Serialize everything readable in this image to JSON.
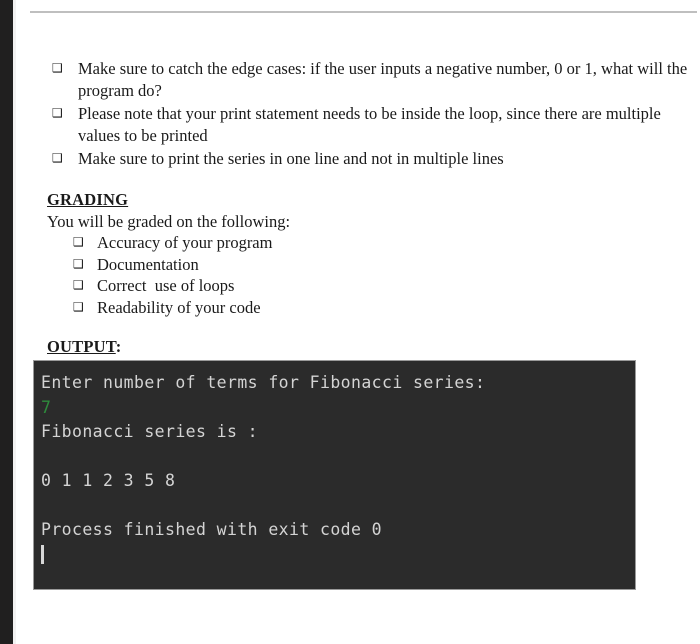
{
  "page": {
    "notes": {
      "bullet_glyph": "❑",
      "items": [
        "Make sure to catch the edge cases: if the user inputs a negative number,  0 or 1, what will the program do?",
        "Please note that your print statement needs to be inside the loop, since there are multiple values to be printed",
        "Make sure to print the series in one line and not in multiple lines"
      ]
    },
    "grading": {
      "heading": "GRADING",
      "intro": "You will be graded on the following:",
      "bullet_glyph": "❑",
      "criteria": [
        "Accuracy of your program",
        "Documentation",
        "Correct  use of loops",
        "Readability of your code"
      ]
    },
    "output": {
      "heading": "OUTPUT",
      "heading_suffix": ":",
      "console": {
        "background_color": "#2b2b2b",
        "text_color": "#d4d4d4",
        "input_echo_color": "#2e8b3c",
        "lines": [
          {
            "text": "Enter number of terms for Fibonacci series:",
            "kind": "stdout"
          },
          {
            "text": "7",
            "kind": "input"
          },
          {
            "text": "Fibonacci series is :",
            "kind": "stdout"
          },
          {
            "text": "",
            "kind": "blank"
          },
          {
            "text": "0 1 1 2 3 5 8",
            "kind": "stdout"
          },
          {
            "text": "",
            "kind": "blank"
          },
          {
            "text": "Process finished with exit code 0",
            "kind": "stdout"
          }
        ],
        "caret": "|"
      }
    }
  }
}
